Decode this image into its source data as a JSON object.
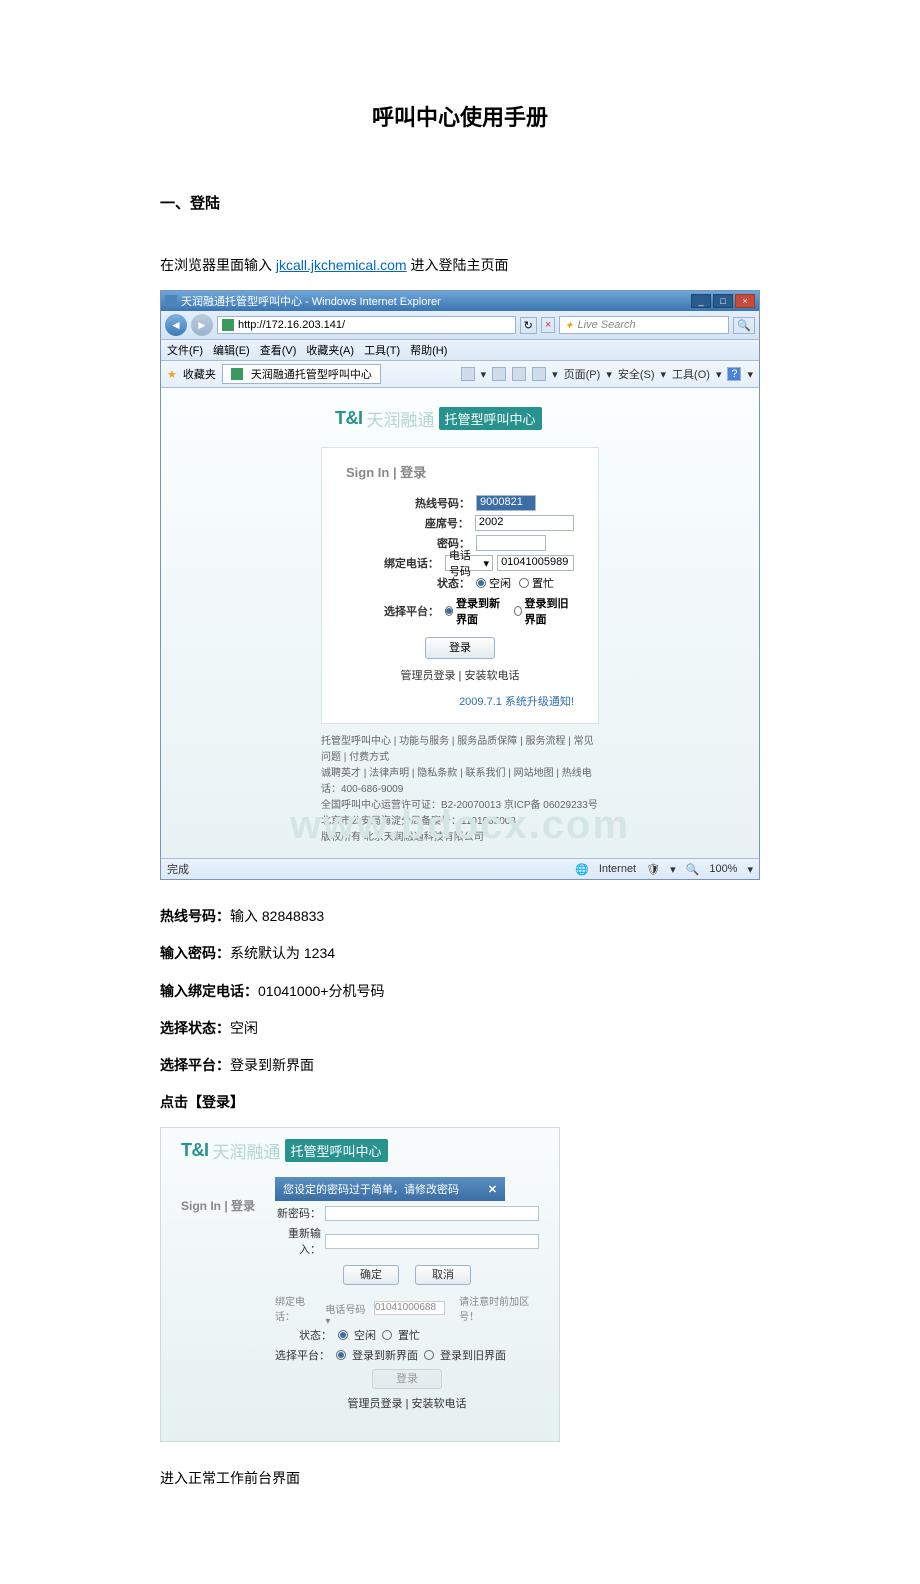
{
  "doc": {
    "title": "呼叫中心使用手册",
    "section1": "一、登陆",
    "intro_pre": "在浏览器里面输入 ",
    "intro_link": "jkcall.jkchemical.com",
    "intro_post": " 进入登陆主页面",
    "i_hotline_l": "热线号码：",
    "i_hotline_v": "输入 82848833",
    "i_pwd_l": "输入密码：",
    "i_pwd_v": "系统默认为 1234",
    "i_bind_l": "输入绑定电话：",
    "i_bind_v": "01041000+分机号码",
    "i_state_l": "选择状态：",
    "i_state_v": "空闲",
    "i_plat_l": "选择平台：",
    "i_plat_v": "登录到新界面",
    "i_click_l": "点击【登录】",
    "closing": "进入正常工作前台界面"
  },
  "ie": {
    "window_title": "天润融通托管型呼叫中心 - Windows Internet Explorer",
    "url": "http://172.16.203.141/",
    "search_placeholder": "Live Search",
    "menu": {
      "file": "文件(F)",
      "edit": "编辑(E)",
      "view": "查看(V)",
      "fav": "收藏夹(A)",
      "tools": "工具(T)",
      "help": "帮助(H)"
    },
    "fav_label": "收藏夹",
    "tab_title": "天润融通托管型呼叫中心",
    "cmd": {
      "page": "页面(P)",
      "safety": "安全(S)",
      "tools": "工具(O)"
    },
    "logo_en": "T&I",
    "logo_cn": "天润融通",
    "logo_badge": "托管型呼叫中心",
    "sign_in": "Sign In | 登录",
    "f_hotline": "热线号码：",
    "f_hotline_val": "9000821",
    "f_seat": "座席号：",
    "f_seat_val": "2002",
    "f_pwd": "密码：",
    "f_bind": "绑定电话：",
    "f_bind_sel": "电话号码",
    "f_bind_val": "01041005989",
    "f_state": "状态：",
    "f_state_idle": "空闲",
    "f_state_busy": "置忙",
    "f_plat": "选择平台：",
    "f_plat_new": "登录到新界面",
    "f_plat_old": "登录到旧界面",
    "login_btn": "登录",
    "links": "管理员登录  | 安装软电话",
    "notice": "2009.7.1 系统升级通知!",
    "footer1": "托管型呼叫中心  |  功能与服务  |  服务品质保障  |  服务流程  |  常见问题  |  付费方式",
    "footer2": "诚聘英才  |  法律声明  |  隐私条款  |  联系我们  |  网站地图  |  热线电话：400-686-9009",
    "footer3": "全国呼叫中心运营许可证：B2-20070013  京ICP备 06029233号  北京市公安局海淀分局备案号：1101085008",
    "footer4": "版权所有 北京天润融通科技有限公司",
    "watermark": "www.bdocx.com",
    "status_done": "完成",
    "status_net": "Internet",
    "status_zoom": "100%"
  },
  "ss2": {
    "dialog_title": "您设定的密码过于简单，请修改密码",
    "new_pwd": "新密码：",
    "re_pwd": "重新输入：",
    "ok": "确定",
    "cancel": "取消",
    "bind_lbl": "绑定电话：",
    "bind_sel": "电话号码",
    "bind_val": "01041000688",
    "bind_tip": "请注意时前加区号！",
    "state_lbl": "状态：",
    "plat_lbl": "选择平台：",
    "login_btn": "登录",
    "links": "管理员登录  | 安装软电话"
  }
}
